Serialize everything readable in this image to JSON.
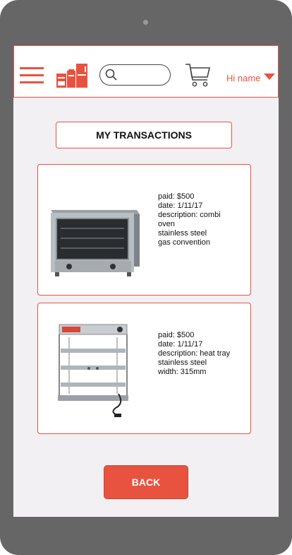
{
  "header": {
    "menu_icon": "hamburger-menu-icon",
    "logo_icon": "kitchen-appliances-logo",
    "search_placeholder": "",
    "cart_icon": "shopping-cart-icon",
    "user_greeting": "Hi name",
    "accent_color": "#e8533f"
  },
  "page": {
    "title": "MY TRANSACTIONS"
  },
  "transactions": [
    {
      "image_icon": "combi-oven-image",
      "paid": "paid: $500",
      "date": "date: 1/11/17",
      "description": "description: combi oven",
      "detail1": "stainless steel",
      "detail2": "gas convention"
    },
    {
      "image_icon": "heat-tray-cabinet-image",
      "paid": "paid: $500",
      "date": "date: 1/11/17",
      "description": "description: heat tray",
      "detail1": "stainless steel",
      "detail2": "width: 315mm"
    }
  ],
  "actions": {
    "back_label": "BACK"
  }
}
